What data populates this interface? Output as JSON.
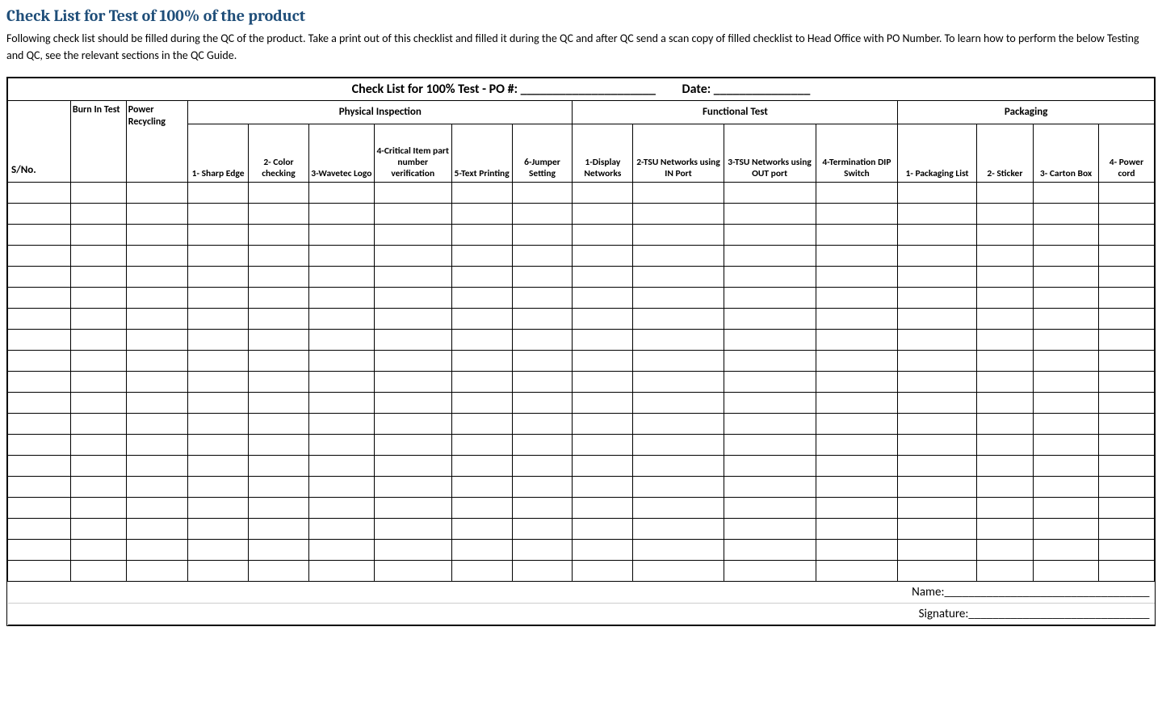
{
  "title": "Check List for Test of 100% of the product",
  "intro": "Following check list should be filled during the QC of the product. Take a print out of this checklist and filled it during the QC and after QC send a scan copy of filled checklist to Head Office with PO Number. To learn how to perform the below Testing and QC, see the relevant sections in the QC Guide.",
  "table_header": "Check List for 100% Test - PO #: _____________________         Date: _______________",
  "columns": {
    "sno": "S/No.",
    "burn_in": "Burn In Test",
    "power_recycling": "Power Recycling",
    "physical_inspection": "Physical Inspection",
    "functional_test": "Functional Test",
    "packaging": "Packaging",
    "pi1": "1- Sharp Edge",
    "pi2": "2- Color checking",
    "pi3": "3-Wavetec Logo",
    "pi4": "4-Critical Item part number verification",
    "pi5": "5-Text Printing",
    "pi6": "6-Jumper Setting",
    "ft1": "1-Display Networks",
    "ft2": "2-TSU Networks using IN Port",
    "ft3": "3-TSU Networks using OUT port",
    "ft4": "4-Termination DIP Switch",
    "pk1": "1- Packaging List",
    "pk2": "2- Sticker",
    "pk3": "3- Carton Box",
    "pk4": "4- Power cord"
  },
  "footer": {
    "name": "Name:__________________________________",
    "signature": "Signature:______________________________"
  },
  "empty_rows": 19
}
